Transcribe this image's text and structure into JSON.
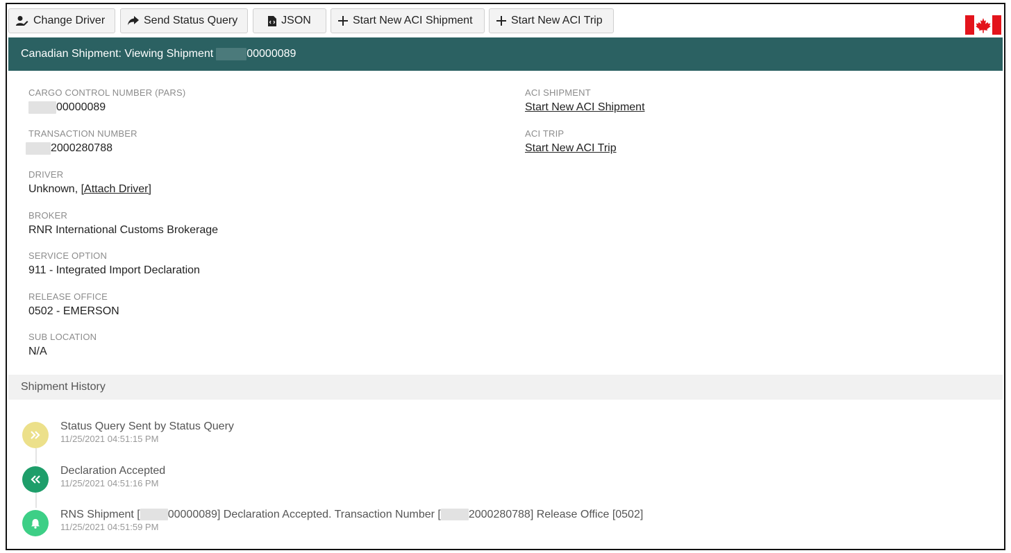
{
  "toolbar": {
    "buttons": [
      {
        "label": "Change Driver",
        "icon": "user-edit-icon"
      },
      {
        "label": "Send Status Query",
        "icon": "share-arrow-icon"
      },
      {
        "label": "JSON",
        "icon": "file-code-icon"
      },
      {
        "label": "Start New ACI Shipment",
        "icon": "plus-icon"
      },
      {
        "label": "Start New ACI Trip",
        "icon": "plus-icon"
      }
    ],
    "flag": "canada-flag-icon"
  },
  "header": {
    "title_prefix": "Canadian Shipment: Viewing Shipment",
    "shipment_suffix": "00000089"
  },
  "details": {
    "ccn_label": "CARGO CONTROL NUMBER (PARS)",
    "ccn_value": "00000089",
    "txn_label": "TRANSACTION NUMBER",
    "txn_value": "2000280788",
    "driver_label": "DRIVER",
    "driver_value": "Unknown, ",
    "driver_link": "[Attach Driver]",
    "broker_label": "BROKER",
    "broker_value": "RNR International Customs Brokerage",
    "service_label": "SERVICE OPTION",
    "service_value": "911 - Integrated Import Declaration",
    "release_label": "RELEASE OFFICE",
    "release_value": "0502 - EMERSON",
    "sub_label": "SUB LOCATION",
    "sub_value": "N/A",
    "aci_shipment_label": "ACI SHIPMENT",
    "aci_shipment_link": "Start New ACI Shipment",
    "aci_trip_label": "ACI TRIP",
    "aci_trip_link": "Start New ACI Trip"
  },
  "history": {
    "title": "Shipment History",
    "entries": [
      {
        "text": "Status Query Sent by Status Query",
        "time": "11/25/2021 04:51:15 PM",
        "icon": "double-chevron-right-icon",
        "color": "#ece08a"
      },
      {
        "text": "Declaration Accepted",
        "time": "11/25/2021 04:51:16 PM",
        "icon": "double-chevron-left-icon",
        "color": "#1e9e6a"
      },
      {
        "text_a": "RNS Shipment [",
        "text_b": "00000089] Declaration Accepted. Transaction Number [",
        "text_c": "2000280788] Release Office [0502]",
        "time": "11/25/2021 04:51:59 PM",
        "icon": "bell-icon",
        "color": "#3dcf86"
      }
    ]
  },
  "colors": {
    "header_bg": "#2b6162",
    "history_bar_bg": "#f1f1f1",
    "flag_red": "#e3141c"
  }
}
